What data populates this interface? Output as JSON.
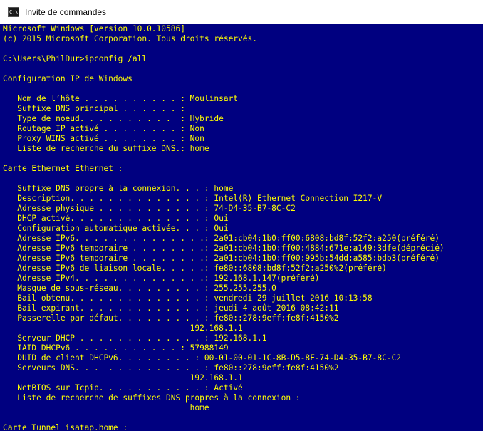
{
  "window": {
    "title": "Invite de commandes",
    "icon": "cmd-icon",
    "icon_text": "C:\\",
    "background": "#000080",
    "text_color": "#ffff00"
  },
  "console": {
    "lines": [
      "Microsoft Windows [version 10.0.10586]",
      "(c) 2015 Microsoft Corporation. Tous droits réservés.",
      "",
      "C:\\Users\\PhilDur>ipconfig /all",
      "",
      "Configuration IP de Windows",
      "",
      "   Nom de l’hôte . . . . . . . . . . : Moulinsart",
      "   Suffixe DNS principal . . . . . . :",
      "   Type de noeud. . . . . . . . . .  : Hybride",
      "   Routage IP activé . . . . . . . . : Non",
      "   Proxy WINS activé . . . . . . . . : Non",
      "   Liste de recherche du suffixe DNS.: home",
      "",
      "Carte Ethernet Ethernet :",
      "",
      "   Suffixe DNS propre à la connexion. . . : home",
      "   Description. . . . . . . . . . . . . . : Intel(R) Ethernet Connection I217-V",
      "   Adresse physique . . . . . . . . . . . : 74-D4-35-B7-8C-C2",
      "   DHCP activé. . . . . . . . . . . . . . : Oui",
      "   Configuration automatique activée. . . : Oui",
      "   Adresse IPv6. . . . . . . . . . . . . .: 2a01:cb04:1b0:ff00:6808:bd8f:52f2:a250(préféré)",
      "   Adresse IPv6 temporaire . . . . . . . .: 2a01:cb04:1b0:ff00:4884:671e:a149:3dfe(déprécié)",
      "   Adresse IPv6 temporaire . . . . . . . .: 2a01:cb04:1b0:ff00:995b:54dd:a585:bdb3(préféré)",
      "   Adresse IPv6 de liaison locale. . . . .: fe80::6808:bd8f:52f2:a250%2(préféré)",
      "   Adresse IPv4. . . . . . . . . . . . . .: 192.168.1.147(préféré)",
      "   Masque de sous-réseau. . . . . . . . . : 255.255.255.0",
      "   Bail obtenu. . . . . . . . . . . . . . : vendredi 29 juillet 2016 10:13:58",
      "   Bail expirant. . . . . . . . . . . . . : jeudi 4 août 2016 08:42:11",
      "   Passerelle par défaut. . . . . . . . . : fe80::278:9eff:fe8f:4150%2",
      "                                       192.168.1.1",
      "   Serveur DHCP . . . . . . . . . . . . . : 192.168.1.1",
      "   IAID DHCPv6 . . . . . . . . . . . : 57988149",
      "   DUID de client DHCPv6. . . . . . . . : 00-01-00-01-1C-8B-D5-8F-74-D4-35-B7-8C-C2",
      "   Serveurs DNS. . .  . . . . . . . . . . : fe80::278:9eff:fe8f:4150%2",
      "                                       192.168.1.1",
      "   NetBIOS sur Tcpip. . . . . . . . . . . : Activé",
      "   Liste de recherche de suffixes DNS propres à la connexion :",
      "                                       home",
      "",
      "Carte Tunnel isatap.home :"
    ]
  }
}
